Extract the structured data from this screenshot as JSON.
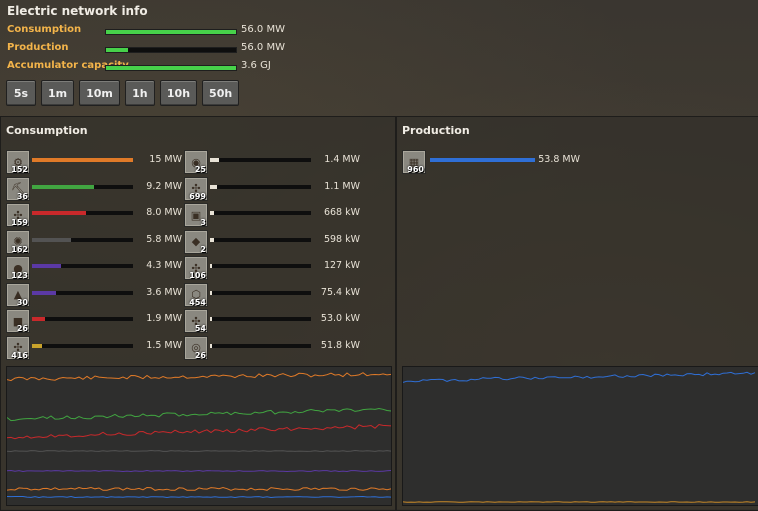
{
  "title": "Electric network info",
  "summary": [
    {
      "label": "Consumption",
      "value": "56.0 MW",
      "fill": 1.0
    },
    {
      "label": "Production",
      "value": "56.0 MW",
      "fill": 0.17
    },
    {
      "label": "Accumulator capacity",
      "value": "3.6 GJ",
      "fill": 1.0
    }
  ],
  "time_buttons": [
    "5s",
    "1m",
    "10m",
    "1h",
    "10h",
    "50h"
  ],
  "consumption": {
    "title": "Consumption",
    "items_left": [
      {
        "icon": "assembling-machine-icon",
        "glyph": "⚙",
        "count": "152",
        "value": "15 MW",
        "fill": 1.0,
        "color": "#e07a28"
      },
      {
        "icon": "electric-mining-drill-icon",
        "glyph": "⛏",
        "count": "36",
        "value": "9.2 MW",
        "fill": 0.61,
        "color": "#41a541"
      },
      {
        "icon": "inserter-icon",
        "glyph": "✣",
        "count": "159",
        "value": "8.0 MW",
        "fill": 0.53,
        "color": "#c9292b"
      },
      {
        "icon": "radar-icon",
        "glyph": "✺",
        "count": "162",
        "value": "5.8 MW",
        "fill": 0.39,
        "color": "#535353"
      },
      {
        "icon": "lamp-icon",
        "glyph": "●",
        "count": "123",
        "value": "4.3 MW",
        "fill": 0.29,
        "color": "#5b39a5"
      },
      {
        "icon": "pumpjack-icon",
        "glyph": "▲",
        "count": "30",
        "value": "3.6 MW",
        "fill": 0.24,
        "color": "#5b39a5"
      },
      {
        "icon": "electric-furnace-icon",
        "glyph": "■",
        "count": "26",
        "value": "1.9 MW",
        "fill": 0.13,
        "color": "#c9292b"
      },
      {
        "icon": "fast-inserter-icon",
        "glyph": "✣",
        "count": "416",
        "value": "1.5 MW",
        "fill": 0.1,
        "color": "#c9a32b"
      }
    ],
    "items_right": [
      {
        "icon": "lab-icon",
        "glyph": "◉",
        "count": "25",
        "value": "1.4 MW",
        "fill": 0.09,
        "color": "#e8e2d6"
      },
      {
        "icon": "long-handed-inserter-icon",
        "glyph": "✣",
        "count": "699",
        "value": "1.1 MW",
        "fill": 0.07,
        "color": "#e8e2d6"
      },
      {
        "icon": "oil-refinery-icon",
        "glyph": "▣",
        "count": "3",
        "value": "668 kW",
        "fill": 0.04,
        "color": "#e8e2d6"
      },
      {
        "icon": "roboport-icon",
        "glyph": "◆",
        "count": "2",
        "value": "598 kW",
        "fill": 0.04,
        "color": "#e8e2d6"
      },
      {
        "icon": "filter-inserter-icon",
        "glyph": "✣",
        "count": "106",
        "value": "127 kW",
        "fill": 0.01,
        "color": "#e8e2d6"
      },
      {
        "icon": "chemical-plant-icon",
        "glyph": "⬡",
        "count": "454",
        "value": "75.4 kW",
        "fill": 0.005,
        "color": "#e8e2d6"
      },
      {
        "icon": "stack-inserter-icon",
        "glyph": "✣",
        "count": "54",
        "value": "53.0 kW",
        "fill": 0.004,
        "color": "#e8e2d6"
      },
      {
        "icon": "centrifuge-icon",
        "glyph": "◎",
        "count": "26",
        "value": "51.8 kW",
        "fill": 0.003,
        "color": "#e8e2d6"
      }
    ]
  },
  "production": {
    "title": "Production",
    "items": [
      {
        "icon": "solar-panel-icon",
        "glyph": "▦",
        "count": "960",
        "value": "53.8 MW",
        "fill": 1.0,
        "color": "#2f6fd6"
      }
    ]
  },
  "colors": {
    "orange": "#e07a28",
    "green": "#41a541",
    "red": "#c9292b",
    "gray": "#535353",
    "purple": "#5b39a5",
    "blue": "#2f6fd6",
    "label": "#f3b44a"
  }
}
